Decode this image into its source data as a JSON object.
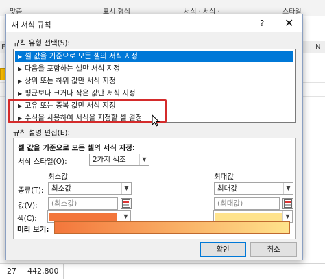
{
  "sheet": {
    "ribbon_groups": [
      "맞춤",
      "표시 형식",
      "서식 · 서식 ·",
      "스타일"
    ],
    "column_labels": [
      "F",
      "N"
    ],
    "bottom_row": {
      "row_number": "27",
      "value": "442,800"
    }
  },
  "dialog": {
    "title": "새 서식 규칙",
    "help": "?",
    "close": "✕",
    "rule_type_label": "규칙 유형 선택(S):",
    "rule_types": [
      "셀 값을 기준으로 모든 셀의 서식 지정",
      "다음을 포함하는 셀만 서식 지정",
      "상위 또는 하위 값만 서식 지정",
      "평균보다 크거나 작은 값만 서식 지정",
      "고유 또는 중복 값만 서식 지정",
      "수식을 사용하여 서식을 지정할 셀 결정"
    ],
    "edit_label": "규칙 설명 편집(E):",
    "edit": {
      "heading": "셀 값을 기준으로 모든 셀의 서식 지정:",
      "format_style_label": "서식 스타일(O):",
      "format_style_value": "2가지 색조",
      "min_header": "최소값",
      "max_header": "최대값",
      "type_label": "종류(T):",
      "min_type": "최소값",
      "max_type": "최대값",
      "value_label": "값(V):",
      "min_value_placeholder": "(최소값)",
      "max_value_placeholder": "(최대값)",
      "color_label": "색(C):",
      "min_color": "#f3763b",
      "max_color": "#ffe38c",
      "preview_label": "미리 보기:"
    },
    "ok": "확인",
    "cancel": "취소"
  }
}
